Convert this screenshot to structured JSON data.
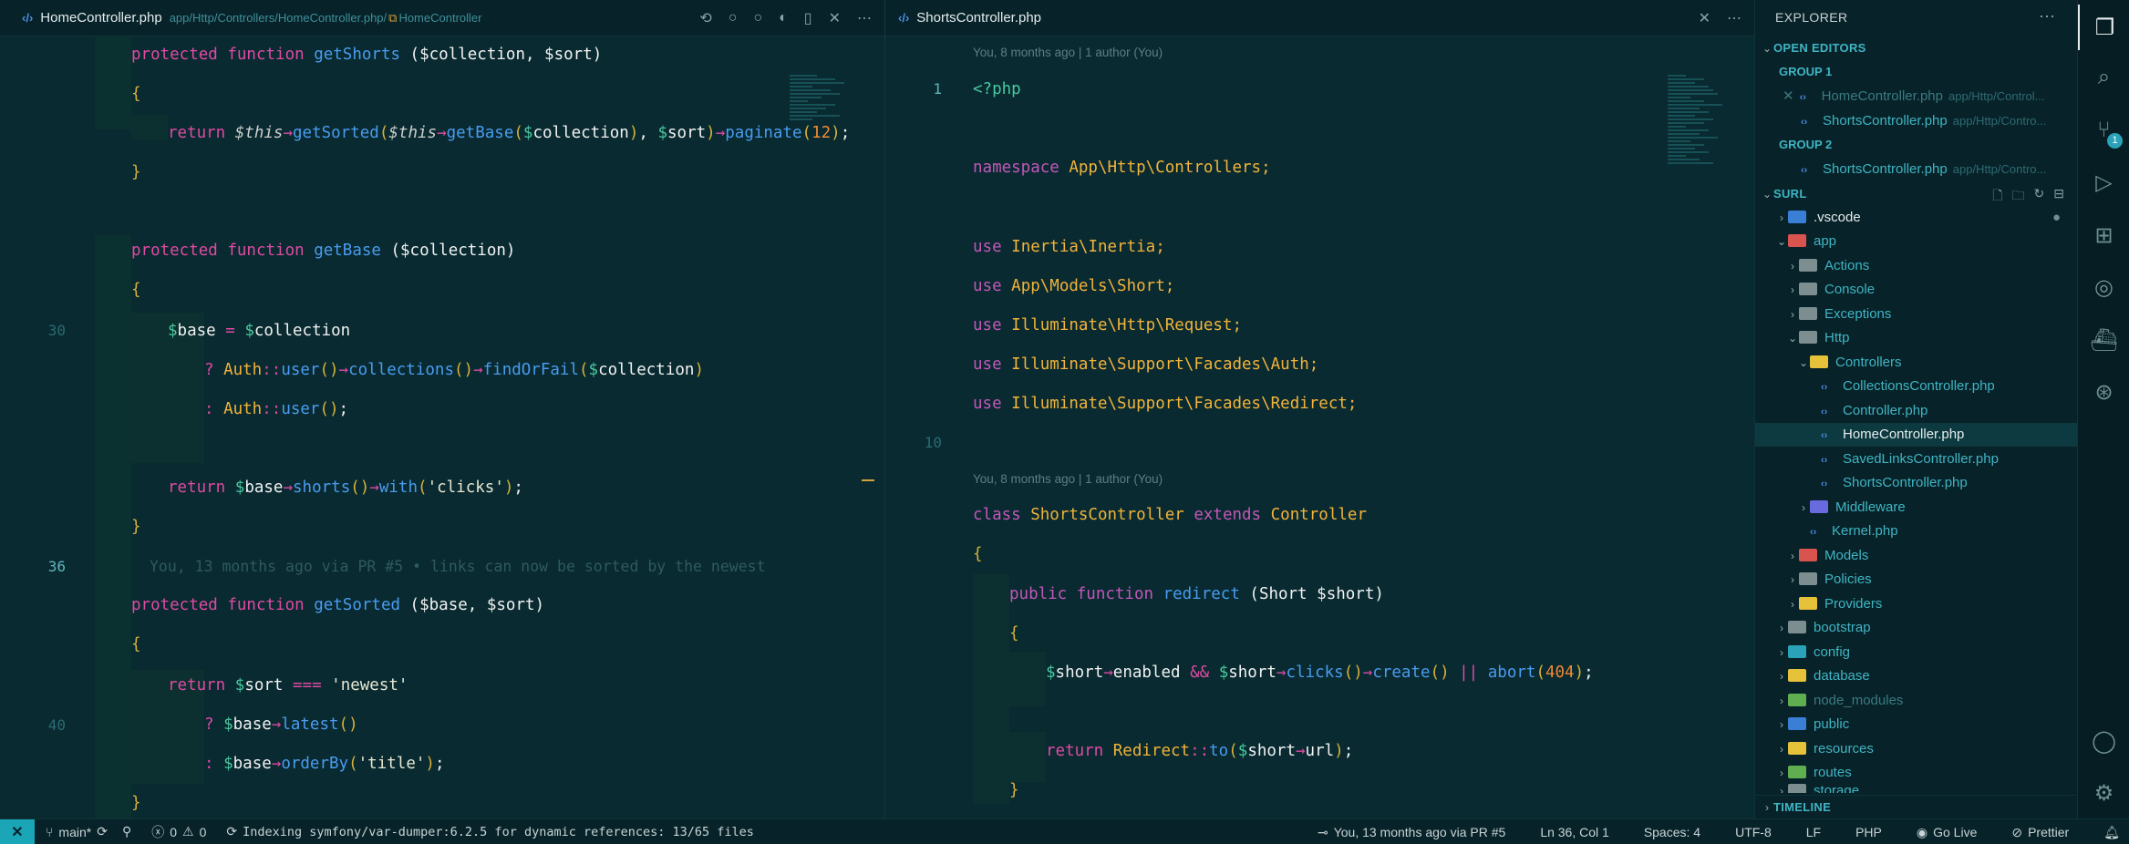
{
  "editor_left": {
    "tab_title": "HomeController.php",
    "breadcrumb_path": "app/Http/Controllers/HomeController.php/",
    "breadcrumb_symbol": "HomeController",
    "line_numbers": {
      "l30": "30",
      "l36": "36",
      "l40": "40"
    },
    "blame_inline": "You, 13 months ago via PR #5 • links can now be sorted by the newest",
    "code": {
      "a1_kw": "protected function ",
      "a1_fn": "getShorts",
      "a1_rest": " ($collection, $sort)",
      "b1_kw": "protected function ",
      "b1_fn": "getBase",
      "b1_rest": " ($collection)",
      "c1_kw": "protected function ",
      "c1_fn": "getSorted",
      "c1_rest": " ($base, $sort)"
    }
  },
  "editor_right": {
    "tab_title": "ShortsController.php",
    "blame_header_1": "You, 8 months ago | 1 author (You)",
    "blame_header_2": "You, 8 months ago | 1 author (You)",
    "line_numbers": {
      "l1": "1",
      "l10": "10"
    },
    "code": {
      "php_open": "<?php",
      "namespace_kw": "namespace ",
      "namespace_val": "App\\Http\\Controllers;",
      "use1": "Inertia\\Inertia;",
      "use2": "App\\Models\\Short;",
      "use3": "Illuminate\\Http\\Request;",
      "use4": "Illuminate\\Support\\Facades\\Auth;",
      "use5": "Illuminate\\Support\\Facades\\Redirect;",
      "use_kw": "use ",
      "class_kw": "class ",
      "class_name": "ShortsController",
      "extends_kw": " extends ",
      "parent": "Controller",
      "public_kw": "public function ",
      "method": "redirect",
      "params": " (Short $short)"
    }
  },
  "sidebar": {
    "title": "EXPLORER",
    "open_editors": "OPEN EDITORS",
    "group1": "GROUP 1",
    "group2": "GROUP 2",
    "open_items": [
      {
        "name": "HomeController.php",
        "path": "app/Http/Control..."
      },
      {
        "name": "ShortsController.php",
        "path": "app/Http/Contro..."
      },
      {
        "name": "ShortsController.php",
        "path": "app/Http/Contro..."
      }
    ],
    "project": "SURL",
    "tree": [
      ".vscode",
      "app",
      "Actions",
      "Console",
      "Exceptions",
      "Http",
      "Controllers",
      "CollectionsController.php",
      "Controller.php",
      "HomeController.php",
      "SavedLinksController.php",
      "ShortsController.php",
      "Middleware",
      "Kernel.php",
      "Models",
      "Policies",
      "Providers",
      "bootstrap",
      "config",
      "database",
      "node_modules",
      "public",
      "resources",
      "routes",
      "storage"
    ],
    "timeline": "TIMELINE"
  },
  "activity": {
    "scm_badge": "1"
  },
  "status": {
    "branch": "main*",
    "errors": "0",
    "warnings": "0",
    "indexing": "Indexing symfony/var-dumper:6.2.5 for dynamic references: 13/65 files",
    "blame": "You, 13 months ago via PR #5",
    "position": "Ln 36, Col 1",
    "spaces": "Spaces: 4",
    "encoding": "UTF-8",
    "eol": "LF",
    "language": "PHP",
    "golive": "Go Live",
    "prettier": "Prettier"
  },
  "colors": {
    "accent": "#1aa6b6",
    "keyword": "#e04aa3",
    "function": "#4a9cf0",
    "class": "#f2b33a",
    "background": "#082a30"
  }
}
